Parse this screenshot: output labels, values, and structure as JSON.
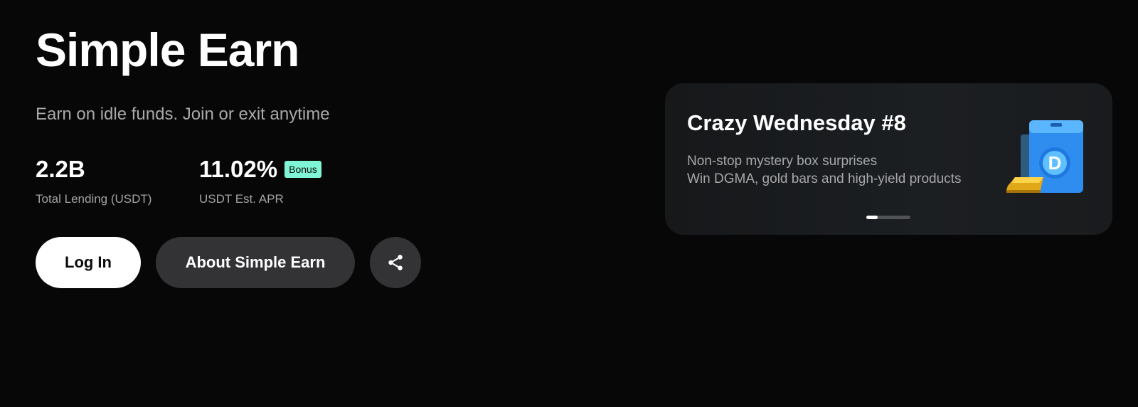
{
  "hero": {
    "title": "Simple Earn",
    "subtitle": "Earn on idle funds. Join or exit anytime"
  },
  "stats": [
    {
      "value": "2.2B",
      "label": "Total Lending (USDT)"
    },
    {
      "value": "11.02%",
      "label": "USDT Est. APR",
      "badge": "Bonus"
    }
  ],
  "actions": {
    "login_label": "Log In",
    "about_label": "About Simple Earn",
    "share_icon": "share-icon"
  },
  "promo": {
    "title": "Crazy Wednesday #8",
    "line1": "Non-stop mystery box surprises",
    "line2": "Win DGMA, gold bars and high-yield products",
    "art_icon": "mystery-box-gold-bar-icon",
    "slide_index": 1,
    "slide_count": 4
  },
  "colors": {
    "background": "#070707",
    "badge": "#7ff5d5",
    "secondary_button": "#333336",
    "card": "#1c1f22"
  }
}
